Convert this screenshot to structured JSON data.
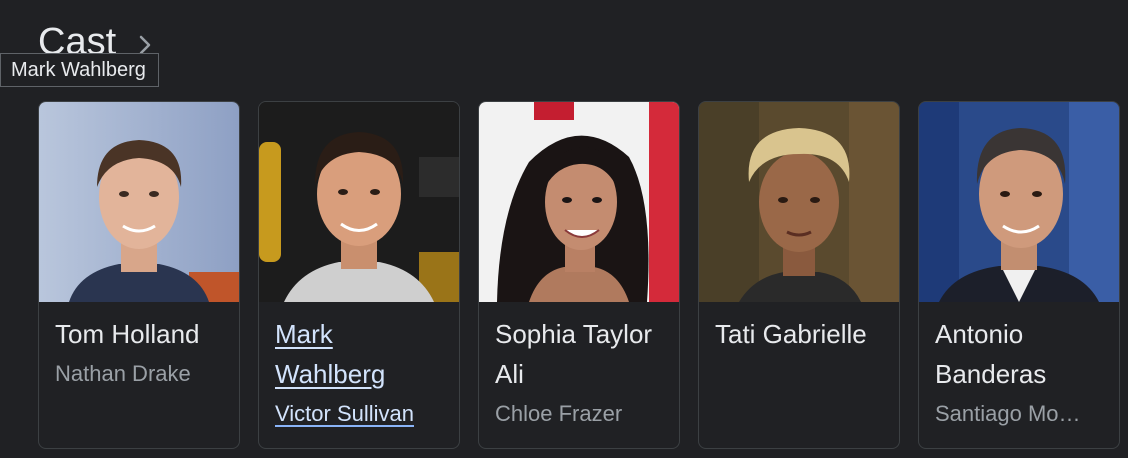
{
  "section": {
    "title": "Cast"
  },
  "tooltip": {
    "text": "Mark Wahlberg"
  },
  "cast": [
    {
      "name": "Tom Holland",
      "role": "Nathan Drake"
    },
    {
      "name": "Mark Wahlberg",
      "role": "Victor Sullivan",
      "hovered": true
    },
    {
      "name": "Sophia Taylor Ali",
      "role": "Chloe Frazer"
    },
    {
      "name": "Tati Gabrielle",
      "role": ""
    },
    {
      "name": "Antonio Banderas",
      "role": "Santiago Mo…"
    }
  ]
}
